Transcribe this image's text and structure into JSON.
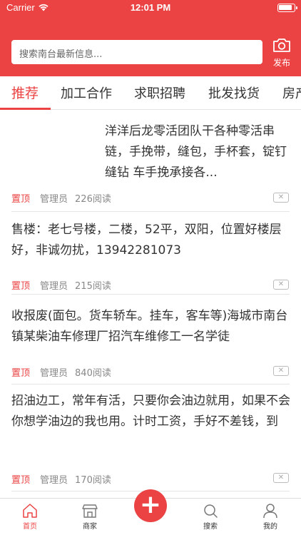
{
  "status_bar": {
    "carrier": "Carrier",
    "time": "12:01 PM"
  },
  "search": {
    "placeholder": "搜索南台最新信息..."
  },
  "publish": {
    "label": "发布",
    "icon": "camera-icon"
  },
  "tabs": [
    {
      "label": "推荐",
      "active": true
    },
    {
      "label": "加工合作"
    },
    {
      "label": "求职招聘"
    },
    {
      "label": "批发找货"
    },
    {
      "label": "房产"
    }
  ],
  "posts": [
    {
      "title": "洋洋后龙零活团队干各种零活串链，手挽带，缝包，手杯套，锭钉 缝钻 车手挽承接各...",
      "tag": "置顶",
      "author": "管理员",
      "reads": "226阅读"
    },
    {
      "title": "售楼：老七号楼，二楼，52平，双阳，位置好楼层好，非诚勿扰，13942281073",
      "tag": "置顶",
      "author": "管理员",
      "reads": "215阅读"
    },
    {
      "title": "收报废(面包。货车轿车。挂车，客车等)海城市南台镇某柴油车修理厂招汽车维修工一名学徒",
      "tag": "置顶",
      "author": "管理员",
      "reads": "840阅读"
    },
    {
      "title": "招油边工，常年有活，只要你会油边就用，如果不会你想学油边的我也用。计时工资，手好不差钱，到",
      "tag": "置顶",
      "author": "管理员",
      "reads": "170阅读"
    }
  ],
  "close_symbol": "✕",
  "tabbar": {
    "items": [
      {
        "label": "首页",
        "icon": "home-icon",
        "active": true
      },
      {
        "label": "商家",
        "icon": "shop-icon"
      },
      {
        "label": "搜索",
        "icon": "search-icon"
      },
      {
        "label": "我的",
        "icon": "user-icon"
      }
    ],
    "fab": "+"
  },
  "colors": {
    "accent": "#eb4343",
    "text": "#333333",
    "meta": "#888888"
  }
}
